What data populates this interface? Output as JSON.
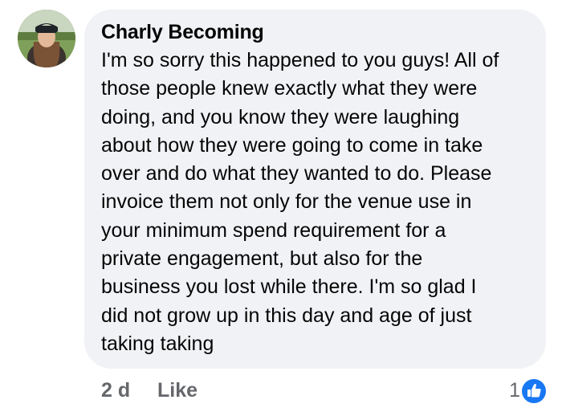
{
  "comment": {
    "author": "Charly Becoming",
    "lines": [
      "I'm so sorry this happened to you guys! All of",
      "those people knew exactly what they were",
      "doing, and you know they were laughing",
      "about how they were going to come in take",
      "over and do what they wanted to do. Please",
      "invoice them not only for the venue use in",
      "your minimum spend requirement for a",
      "private engagement, but also for the",
      "business you lost while there. I'm so glad I",
      "did not grow up in this day and age of just",
      "taking taking"
    ],
    "timestamp": "2 d",
    "like_label": "Like",
    "reaction_count": "1",
    "reaction_icon": "thumbs-up-icon",
    "reaction_color": "#1877f2"
  }
}
